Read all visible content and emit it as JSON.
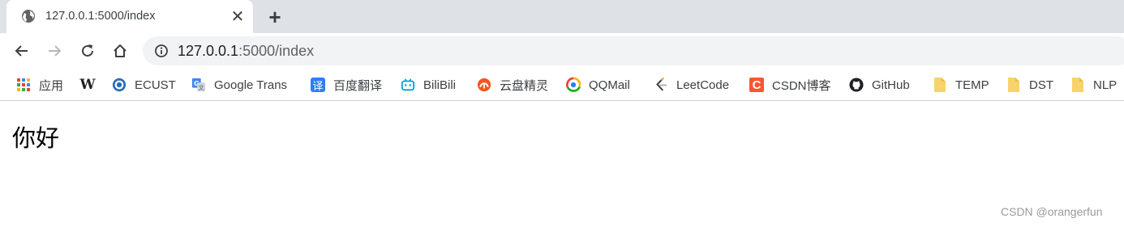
{
  "tab": {
    "title": "127.0.0.1:5000/index",
    "close_glyph": "✕",
    "new_tab_glyph": "+"
  },
  "address": {
    "host": "127.0.0.1",
    "rest": ":5000/index"
  },
  "bookmarks": [
    {
      "label": "应用",
      "icon": "apps-grid-icon"
    },
    {
      "label": "",
      "icon": "wikipedia-icon",
      "glyph": "W"
    },
    {
      "label": "ECUST",
      "icon": "ecust-icon"
    },
    {
      "label": "Google Trans",
      "icon": "google-translate-icon"
    },
    {
      "label": "百度翻译",
      "icon": "baidu-translate-icon",
      "glyph": "译"
    },
    {
      "label": "BiliBili",
      "icon": "bilibili-icon"
    },
    {
      "label": "云盘精灵",
      "icon": "cloud-disk-icon"
    },
    {
      "label": "QQMail",
      "icon": "qqmail-icon"
    },
    {
      "label": "LeetCode",
      "icon": "leetcode-icon"
    },
    {
      "label": "CSDN博客",
      "icon": "csdn-icon",
      "glyph": "C"
    },
    {
      "label": "GitHub",
      "icon": "github-icon"
    },
    {
      "label": "TEMP",
      "icon": "folder-icon"
    },
    {
      "label": "DST",
      "icon": "folder-icon"
    },
    {
      "label": "NLP",
      "icon": "folder-icon"
    }
  ],
  "colors": {
    "tabstrip": "#dee1e6",
    "omnibox": "#f1f3f4",
    "folder": "#f7d36b",
    "csdn": "#fc5531",
    "baidu": "#2f7cf6",
    "bilibili": "#00a1d6",
    "clouddisk": "#f2581f"
  },
  "page": {
    "greeting": "你好"
  },
  "watermark": "CSDN @orangerfun"
}
